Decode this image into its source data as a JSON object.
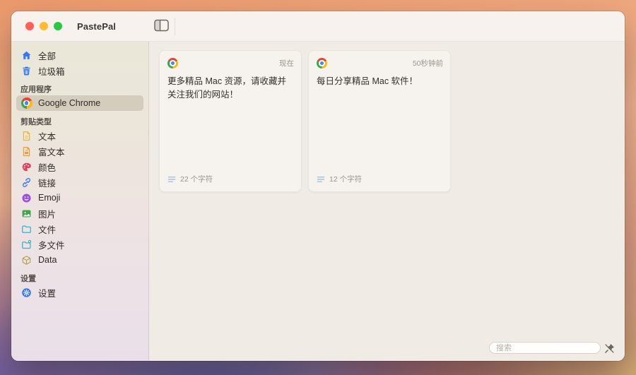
{
  "window": {
    "title": "PastePal",
    "traffic_lights": {
      "close_color": "#FF5F57",
      "minimize_color": "#FEBC2E",
      "zoom_color": "#28C840"
    },
    "toolbar": {
      "sidebar_toggle_icon": "sidebar-toggle-icon"
    }
  },
  "sidebar": {
    "items": [
      {
        "kind": "item",
        "icon": "house-icon",
        "icon_color": "#3478F6",
        "label": "全部"
      },
      {
        "kind": "item",
        "icon": "trash-icon",
        "icon_color": "#3478F6",
        "label": "垃圾箱"
      },
      {
        "kind": "header",
        "label": "应用程序"
      },
      {
        "kind": "item",
        "icon": "chrome-icon",
        "label": "Google Chrome",
        "selected": true
      },
      {
        "kind": "header",
        "label": "剪贴类型"
      },
      {
        "kind": "item",
        "icon": "text-document-icon",
        "icon_color": "#E5B93C",
        "label": "文本"
      },
      {
        "kind": "item",
        "icon": "rich-text-document-icon",
        "icon_color": "#F09A3E",
        "label": "富文本"
      },
      {
        "kind": "item",
        "icon": "color-palette-icon",
        "icon_color": "#E4405F",
        "label": "颜色"
      },
      {
        "kind": "item",
        "icon": "link-icon",
        "icon_color": "#3E7BF6",
        "label": "链接"
      },
      {
        "kind": "item",
        "icon": "emoji-icon",
        "icon_color": "#9B51E0",
        "label": "Emoji"
      },
      {
        "kind": "item",
        "icon": "image-icon",
        "icon_color": "#3FA54A",
        "label": "图片"
      },
      {
        "kind": "item",
        "icon": "folder-icon",
        "icon_color": "#36B3C4",
        "label": "文件"
      },
      {
        "kind": "item",
        "icon": "multi-folder-icon",
        "icon_color": "#36B3C4",
        "label": "多文件"
      },
      {
        "kind": "item",
        "icon": "cube-icon",
        "icon_color": "#B5A14E",
        "label": "Data"
      },
      {
        "kind": "header",
        "label": "设置"
      },
      {
        "kind": "item",
        "icon": "settings-gear-icon",
        "icon_color": "#3478F6",
        "label": "设置"
      }
    ]
  },
  "main": {
    "cards": [
      {
        "app_icon": "chrome-icon",
        "timestamp": "现在",
        "text": "更多精品 Mac 资源，请收藏并关注我们的网站！",
        "footer_icon": "text-lines-icon",
        "char_count": "22 个字符"
      },
      {
        "app_icon": "chrome-icon",
        "timestamp": "50秒钟前",
        "text": "每日分享精品 Mac 软件！",
        "footer_icon": "text-lines-icon",
        "char_count": "12 个字符"
      }
    ],
    "search": {
      "placeholder": "搜索"
    },
    "filter_icon": "pin-slash-icon"
  },
  "colors": {
    "titlebar_bg": "#F7F2EE",
    "sidebar_top_bg": "#EAE7D9",
    "sidebar_bottom_bg": "#E9DFE8",
    "sidebar_selected_bg": "#D9CFC1",
    "main_bg": "#F1EBE6",
    "card_bg": "#F6F2EE",
    "accent_blue": "#3478F6",
    "muted_text": "#9C958D"
  }
}
